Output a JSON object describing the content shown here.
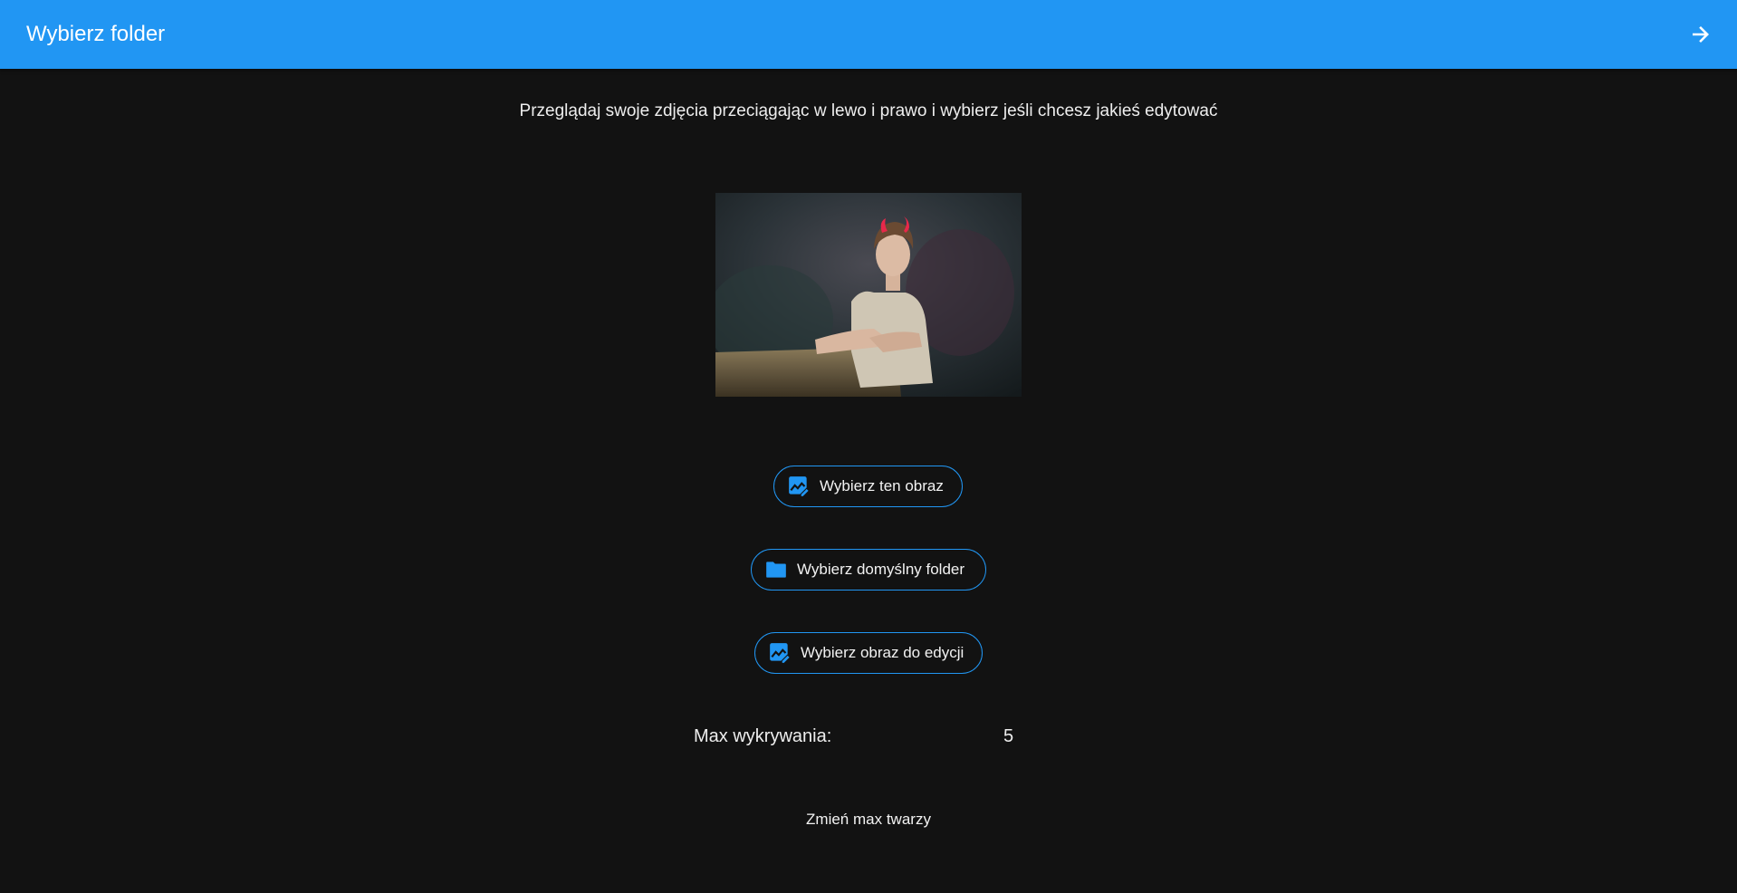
{
  "appbar": {
    "title": "Wybierz folder",
    "action_icon": "arrow-right-icon"
  },
  "instruction": "Przeglądaj swoje zdjęcia przeciągając w lewo i prawo i wybierz jeśli chcesz jakieś edytować",
  "buttons": {
    "select_image": {
      "label": "Wybierz ten obraz",
      "icon": "image-edit-icon"
    },
    "default_folder": {
      "label": "Wybierz domyślny folder",
      "icon": "folder-icon"
    },
    "image_for_edit": {
      "label": "Wybierz obraz do edycji",
      "icon": "image-edit-icon"
    }
  },
  "max_detect": {
    "label": "Max wykrywania:",
    "value": "5"
  },
  "change_max_faces": "Zmień max twarzy",
  "colors": {
    "primary": "#2196f3",
    "background": "#121212"
  }
}
